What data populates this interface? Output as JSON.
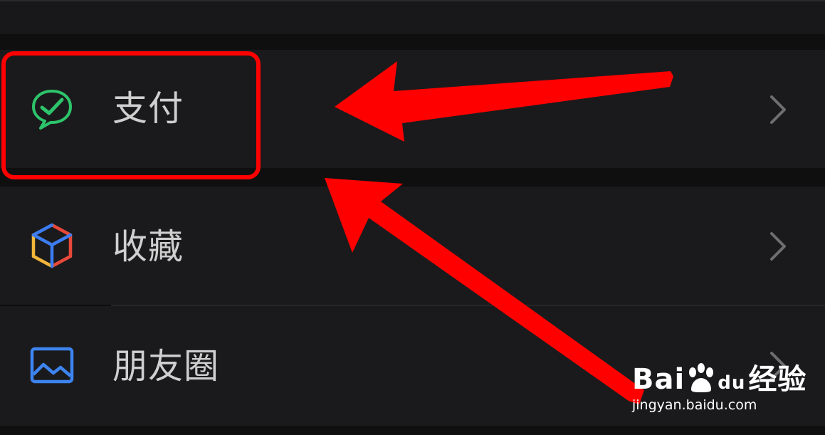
{
  "menu": {
    "items": [
      {
        "label": "支付",
        "icon": "wechat-pay-icon"
      },
      {
        "label": "收藏",
        "icon": "favorites-cube-icon"
      },
      {
        "label": "朋友圈",
        "icon": "moments-photo-icon"
      }
    ]
  },
  "watermark": {
    "brand_left": "Bai",
    "brand_mid": "du",
    "brand_right": "经验",
    "url": "jingyan.baidu.com"
  },
  "colors": {
    "background": "#1a1a1c",
    "label": "#cfcfcf",
    "highlight": "#ff0000",
    "pay_green": "#2dc46b"
  }
}
